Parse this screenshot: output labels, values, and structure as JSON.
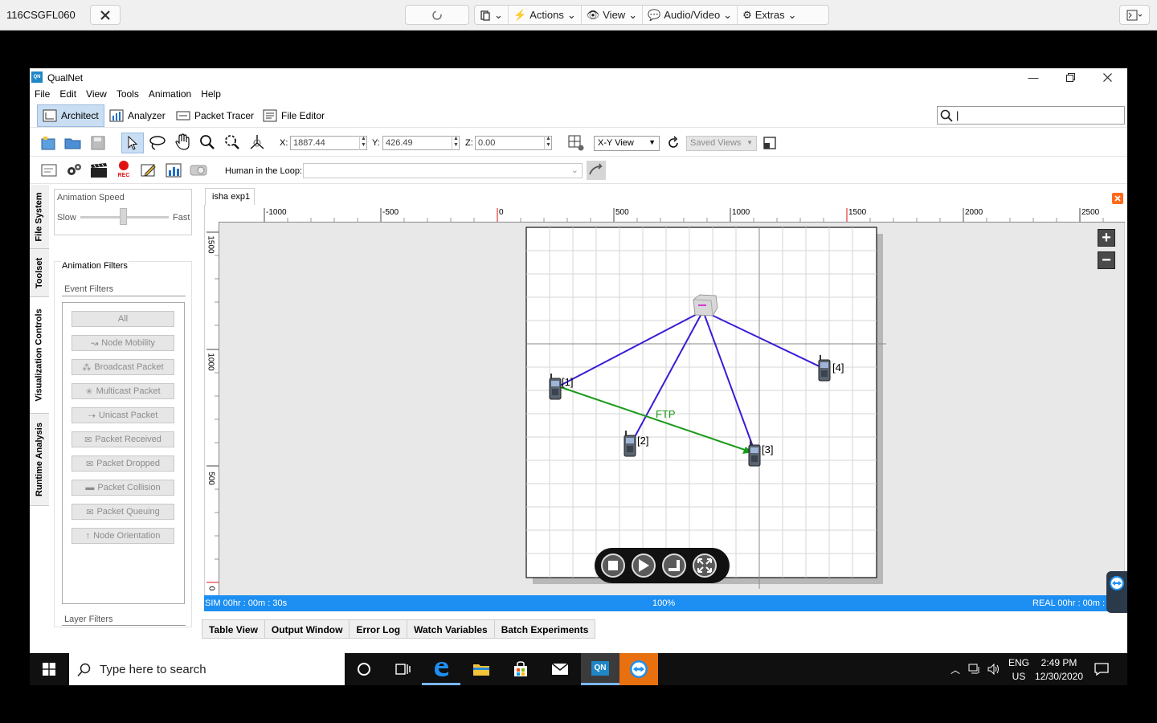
{
  "remote_bar": {
    "host": "116CSGFL060",
    "actions": "Actions",
    "view": "View",
    "audio_video": "Audio/Video",
    "extras": "Extras"
  },
  "window": {
    "title": "QualNet",
    "logo_text": "QN",
    "menu": [
      "File",
      "Edit",
      "View",
      "Tools",
      "Animation",
      "Help"
    ],
    "modes": [
      "Architect",
      "Analyzer",
      "Packet Tracer",
      "File Editor"
    ],
    "search_value": "|"
  },
  "toolbar": {
    "x_label": "X:",
    "x_value": "1887.44",
    "y_label": "Y:",
    "y_value": "426.49",
    "z_label": "Z:",
    "z_value": "0.00",
    "view_select": "X-Y View",
    "saved_views": "Saved Views",
    "hitl_label": "Human in the Loop:",
    "rec_label": "REC"
  },
  "side_tabs": [
    "File System",
    "Toolset",
    "Visualization Controls",
    "Runtime Analysis"
  ],
  "left_panel": {
    "anim_speed_title": "Animation Speed",
    "slow": "Slow",
    "fast": "Fast",
    "anim_filters_title": "Animation Filters",
    "event_filters": "Event Filters",
    "filters": [
      "All",
      "Node Mobility",
      "Broadcast Packet",
      "Multicast Packet",
      "Unicast Packet",
      "Packet Received",
      "Packet Dropped",
      "Packet Collision",
      "Packet Queuing",
      "Node Orientation"
    ],
    "layer_filters": "Layer Filters"
  },
  "canvas": {
    "doc_tab": "isha exp1",
    "h_ruler": [
      "-1000",
      "-500",
      "0",
      "500",
      "1000",
      "1500",
      "2000",
      "2500"
    ],
    "v_ruler": [
      "1500",
      "1000",
      "500",
      "0"
    ],
    "nodes": [
      "[1]",
      "[2]",
      "[3]",
      "[4]"
    ],
    "ftp_label": "FTP",
    "colors": {
      "link": "#3b1bd6",
      "ftp": "#1a9a1a",
      "status": "#1e8ff2"
    }
  },
  "status": {
    "sim": "SIM 00hr : 00m : 30s",
    "progress": "100%",
    "real": "REAL 00hr : 00m :"
  },
  "bottom_tabs": [
    "Table View",
    "Output Window",
    "Error Log",
    "Watch Variables",
    "Batch Experiments"
  ],
  "taskbar": {
    "search_placeholder": "Type here to search",
    "lang": "ENG",
    "region": "US",
    "time": "2:49 PM",
    "date": "12/30/2020",
    "qn_label": "QN"
  }
}
